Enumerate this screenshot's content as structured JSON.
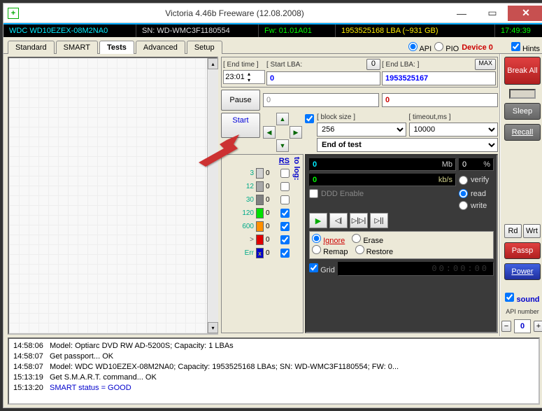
{
  "window": {
    "title": "Victoria 4.46b Freeware (12.08.2008)"
  },
  "info": {
    "model": "WDC WD10EZEX-08M2NA0",
    "serial": "SN: WD-WMC3F1180554",
    "firmware": "Fw: 01.01A01",
    "lba": "1953525168 LBA (~931 GB)",
    "clock": "17:49:39"
  },
  "tabs": {
    "t1": "Standard",
    "t2": "SMART",
    "t3": "Tests",
    "t4": "Advanced",
    "t5": "Setup"
  },
  "mode": {
    "api": "API",
    "pio": "PIO",
    "device": "Device 0",
    "hints": "Hints"
  },
  "test": {
    "end_time_label": "[ End time ]",
    "start_lba_label": "[ Start LBA:",
    "start_lba_btn": "0",
    "end_lba_label": "[ End LBA: ]",
    "end_lba_btn": "MAX",
    "end_time": "23:01",
    "start_lba": "0",
    "end_lba": "1953525167",
    "pause": "Pause",
    "start": "Start",
    "cur1": "0",
    "cur2": "0",
    "block_label": "[ block size ]",
    "block": "256",
    "timeout_label": "[ timeout,ms ]",
    "timeout": "10000",
    "eot": "End of test"
  },
  "stats": {
    "rs": "RS",
    "tolog": "to log:",
    "rows": [
      {
        "n": "3",
        "c": "#d0d0d0",
        "v": "0"
      },
      {
        "n": "12",
        "c": "#a8a8a8",
        "v": "0"
      },
      {
        "n": "30",
        "c": "#808080",
        "v": "0"
      },
      {
        "n": "120",
        "c": "#00e000",
        "v": "0"
      },
      {
        "n": "600",
        "c": "#ff9000",
        "v": "0"
      },
      {
        "n": ">",
        "c": "#e00000",
        "v": "0"
      }
    ],
    "err_label": "Err",
    "err_val": "0"
  },
  "perf": {
    "mb_val": "0",
    "mb_unit": "Mb",
    "pct_val": "0",
    "pct_unit": "%",
    "kbs_val": "0",
    "kbs_unit": "kb/s",
    "ddd": "DDD Enable",
    "verify": "verify",
    "read": "read",
    "write": "write",
    "ignore": "Ignore",
    "erase": "Erase",
    "remap": "Remap",
    "restore": "Restore",
    "grid": "Grid",
    "counter": "00:00:00"
  },
  "side": {
    "break": "Break All",
    "sleep": "Sleep",
    "recall": "Recall",
    "rd": "Rd",
    "wrt": "Wrt",
    "passp": "Passp",
    "power": "Power",
    "sound": "sound",
    "api_num_label": "API number",
    "api_num": "0"
  },
  "log": {
    "l1t": "14:58:06",
    "l1": "Model: Optiarc DVD RW AD-5200S; Capacity: 1 LBAs",
    "l2t": "14:58:07",
    "l2": "Get passport... OK",
    "l3t": "14:58:07",
    "l3": "Model: WDC WD10EZEX-08M2NA0; Capacity: 1953525168 LBAs; SN: WD-WMC3F1180554; FW: 0...",
    "l4t": "15:13:19",
    "l4": "Get S.M.A.R.T. command... OK",
    "l5t": "15:13:20",
    "l5": "SMART status = GOOD"
  }
}
